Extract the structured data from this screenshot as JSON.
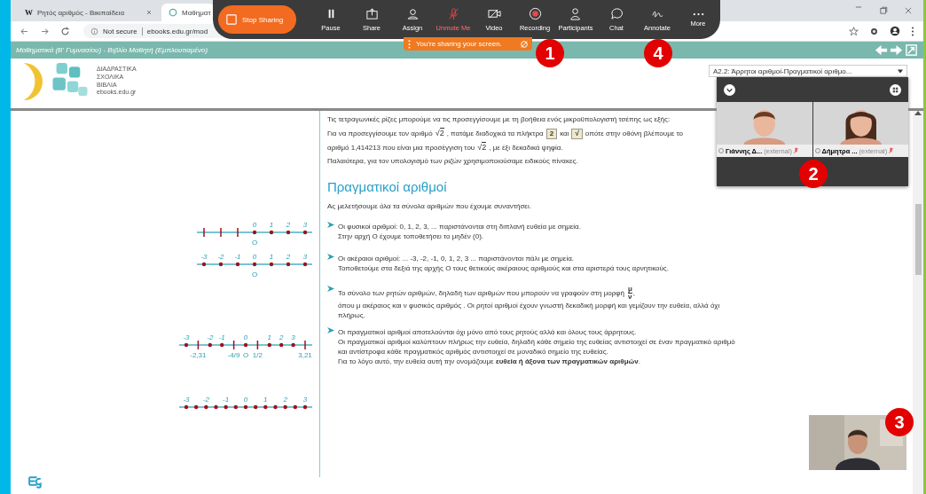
{
  "browser": {
    "tabs": [
      {
        "title": "Ρητός αριθμός - Βικιπαίδεια",
        "favicon_letter": "W",
        "selected": false
      },
      {
        "title": "Μαθηματ",
        "selected": true
      }
    ],
    "address": {
      "security": "Not secure",
      "url": "ebooks.edu.gr/mod"
    }
  },
  "site_bar": {
    "title": "Μαθηματικά (Β' Γυμνασίου) - Βιβλίο Μαθητή (Εμπλουτισμένο)"
  },
  "logo": {
    "lines": [
      "ΔΙΑΔΡΑΣΤΙΚΑ",
      "ΣΧΟΛΙΚΑ",
      "ΒΙΒΛΙΑ"
    ],
    "domain": "ebooks.edu.gr"
  },
  "chapter_select": {
    "value": "Α2.2: Άρρητοι αριθμοί-Πραγματικοί αριθμο..."
  },
  "intro_paragraphs": [
    [
      {
        "kind": "text",
        "t": "Τις τετραγωνικές ρίζες μπορούμε να τις προσεγγίσουμε με τη βοήθεια ενός μικροϋπολογιστή τσέπης ως εξής:"
      }
    ],
    [
      {
        "kind": "text",
        "t": "Για να προσεγγίσουμε τον αριθμό"
      },
      {
        "kind": "root",
        "sign": "√",
        "t": "2"
      },
      {
        "kind": "text",
        "t": ", πατάμε διαδοχικά τα πλήκτρα"
      },
      {
        "kind": "key",
        "t": "2"
      },
      {
        "kind": "text",
        "t": "και"
      },
      {
        "kind": "key",
        "t": "√"
      },
      {
        "kind": "text",
        "t": "οπότε στην οθόνη βλέπουμε το"
      }
    ],
    [
      {
        "kind": "text",
        "t": "αριθμό 1,414213 που είναι μια προσέγγιση του"
      },
      {
        "kind": "root",
        "sign": "√",
        "t": "2"
      },
      {
        "kind": "text",
        "t": ", με έξι δεκαδικά ψηφία."
      }
    ],
    [
      {
        "kind": "text",
        "t": "Παλαιότερα, για τον υπολογισμό των ριζών χρησιμοποιούσαμε ειδικούς πίνακες."
      }
    ]
  ],
  "heading": "Πραγματικοί αριθμοί",
  "lead": "Ας μελετήσουμε όλα τα σύνολα αριθμών που έχουμε συναντήσει.",
  "bullets": [
    {
      "lines": [
        [
          {
            "kind": "text",
            "t": "Οι φυσικοί αριθμοί: 0, 1, 2, 3, ... παριστάνονται στη διπλανή ευθεία με σημεία."
          }
        ],
        [
          {
            "kind": "text",
            "t": "Στην αρχή Ο έχουμε τοποθετήσει το μηδέν (0)."
          }
        ]
      ],
      "number_line": {
        "ticks": [
          {
            "dot": false
          },
          {
            "dot": false
          },
          {
            "dot": false
          },
          {
            "dot": true,
            "label": "0",
            "below": "O"
          },
          {
            "dot": true,
            "label": "1"
          },
          {
            "dot": true,
            "label": "2"
          },
          {
            "dot": true,
            "label": "3"
          }
        ]
      }
    },
    {
      "lines": [
        [
          {
            "kind": "text",
            "t": "Οι ακέραιοι αριθμοί: ... -3, -2, -1, 0, 1, 2, 3 ... παριστάνονται πάλι με σημεία."
          }
        ],
        [
          {
            "kind": "text",
            "t": "Τοποθετούμε στα δεξιά της αρχής Ο τους θετικούς ακέραιους αριθμούς και στα αριστερά τους αρνητικούς."
          }
        ]
      ],
      "number_line": {
        "ticks": [
          {
            "dot": true,
            "label": "-3"
          },
          {
            "dot": true,
            "label": "-2"
          },
          {
            "dot": true,
            "label": "-1"
          },
          {
            "dot": true,
            "label": "0",
            "below": "O"
          },
          {
            "dot": true,
            "label": "1"
          },
          {
            "dot": true,
            "label": "2"
          },
          {
            "dot": true,
            "label": "3"
          }
        ]
      }
    },
    {
      "lines": [
        [
          {
            "kind": "text",
            "t": "Το σύνολο των ρητών αριθμών, δηλαδή των αριθμών που μπορούν να γραφούν στη μορφή"
          },
          {
            "kind": "fraction",
            "t": "μ",
            "d": "ν"
          },
          {
            "kind": "text",
            "t": ","
          }
        ],
        [
          {
            "kind": "text",
            "t": "όπου μ ακέραιος και ν  φυσικός αριθμός . Οι ρητοί αριθμοί έχουν γνωστή δεκαδική μορφή και γεμίζουν την ευθεία, αλλά όχι πλήρως."
          }
        ]
      ]
    },
    {
      "lines": [
        [
          {
            "kind": "text",
            "t": "Οι πραγματικοί αριθμοί αποτελούνται όχι μόνο από τους ρητούς αλλά και όλους τους άρρητους."
          }
        ],
        [
          {
            "kind": "text",
            "t": "Οι πραγματικοί αριθμοί καλύπτουν πλήρως την ευθεία, δηλαδή κάθε σημείο της ευθείας αντιστοιχεί σε έναν πραγματικό αριθμό και αντίστροφα κάθε πραγματικός αριθμός αντιστοιχεί σε μοναδικό σημείο της ευθείας."
          }
        ],
        [
          {
            "kind": "rich",
            "t": "Για το λόγο αυτό, την ευθεία αυτή την ονομάζουμε **ευθεία ή άξονα των πραγματικών αριθμών**."
          }
        ]
      ],
      "number_line": {
        "ticks": [
          {
            "dot": true,
            "label": "-3"
          },
          {
            "dot": false,
            "below": "-2,31"
          },
          {
            "dot": true,
            "label": "-2"
          },
          {
            "dot": true,
            "label": "-1"
          },
          {
            "dot": false,
            "below": "-4/9"
          },
          {
            "dot": true,
            "label": "0",
            "below": "O"
          },
          {
            "dot": false,
            "below": "1/2"
          },
          {
            "dot": true,
            "label": "1"
          },
          {
            "dot": true,
            "label": "2"
          },
          {
            "dot": true,
            "label": "3"
          },
          {
            "dot": false,
            "below": "3,21"
          }
        ]
      }
    }
  ],
  "extra_number_line": {
    "ticks": [
      {
        "dot": true,
        "label": "-3"
      },
      {
        "dot": true
      },
      {
        "dot": true,
        "label": "-2"
      },
      {
        "dot": true
      },
      {
        "dot": true,
        "label": "-1"
      },
      {
        "dot": true
      },
      {
        "dot": true,
        "label": "0"
      },
      {
        "dot": true
      },
      {
        "dot": true,
        "label": "1"
      },
      {
        "dot": true
      },
      {
        "dot": true,
        "label": "2"
      },
      {
        "dot": true
      },
      {
        "dot": true,
        "label": "3"
      }
    ]
  },
  "meeting_toolbar": {
    "stop_button": "Stop Sharing",
    "items": [
      {
        "label": "Pause"
      },
      {
        "label": "Share"
      },
      {
        "label": "Assign"
      },
      {
        "label": "Unmute Me",
        "muted": true
      },
      {
        "label": "Video"
      },
      {
        "label": "Recording"
      },
      {
        "label": "Participants"
      },
      {
        "label": "Chat"
      },
      {
        "label": "Annotate"
      },
      {
        "label": "More"
      }
    ]
  },
  "share_banner": "You're sharing your screen.",
  "video_panel": {
    "tiles": [
      {
        "name": "Γιάννης Δ...",
        "tag": "(external)",
        "muted": true
      },
      {
        "name": "Δήμητρα ...",
        "tag": "(external)",
        "muted": true
      }
    ]
  },
  "callouts": [
    "1",
    "4",
    "2",
    "3"
  ]
}
